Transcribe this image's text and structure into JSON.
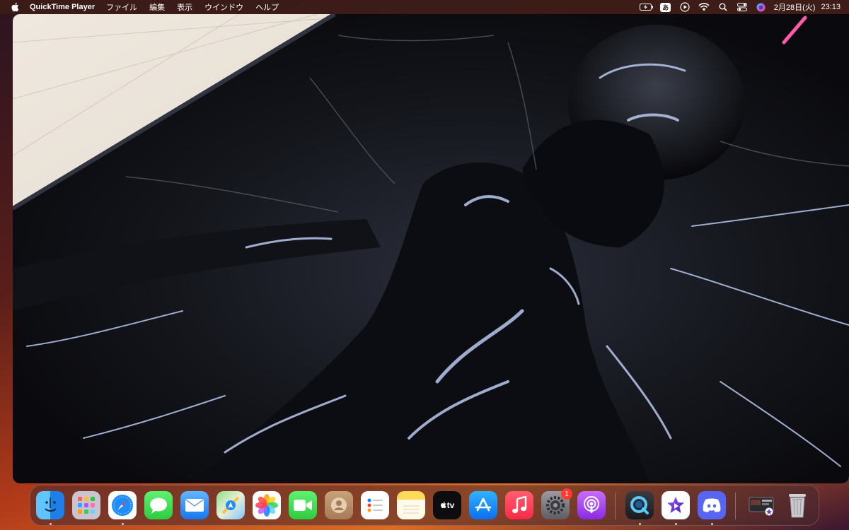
{
  "menubar": {
    "app_name": "QuickTime Player",
    "menus": [
      "ファイル",
      "編集",
      "表示",
      "ウインドウ",
      "ヘルプ"
    ],
    "input_method": "あ",
    "date": "2月28日(火)",
    "time": "23:13"
  },
  "player": {
    "content": "video-frame"
  },
  "dock": {
    "items": [
      {
        "name": "Finder",
        "icon": "finder-icon",
        "running": true
      },
      {
        "name": "Launchpad",
        "icon": "launchpad-icon",
        "running": false
      },
      {
        "name": "Safari",
        "icon": "safari-icon",
        "running": true
      },
      {
        "name": "Messages",
        "icon": "messages-icon",
        "running": false
      },
      {
        "name": "Mail",
        "icon": "mail-icon",
        "running": false
      },
      {
        "name": "Maps",
        "icon": "maps-icon",
        "running": false
      },
      {
        "name": "Photos",
        "icon": "photos-icon",
        "running": false
      },
      {
        "name": "FaceTime",
        "icon": "facetime-icon",
        "running": false
      },
      {
        "name": "Contacts",
        "icon": "contacts-icon",
        "running": false
      },
      {
        "name": "Reminders",
        "icon": "reminders-icon",
        "running": false
      },
      {
        "name": "Notes",
        "icon": "notes-icon",
        "running": false
      },
      {
        "name": "TV",
        "icon": "tv-icon",
        "label": "tv",
        "running": false
      },
      {
        "name": "App Store",
        "icon": "app-store-icon",
        "running": false
      },
      {
        "name": "Music",
        "icon": "music-icon",
        "running": false
      },
      {
        "name": "System Settings",
        "icon": "system-settings-icon",
        "badge": "1",
        "running": false
      },
      {
        "name": "Podcasts",
        "icon": "podcasts-icon",
        "running": false
      },
      {
        "name": "QuickTime Player",
        "icon": "quicktime-icon",
        "running": true
      },
      {
        "name": "iMovie",
        "icon": "imovie-icon",
        "running": true
      },
      {
        "name": "Discord",
        "icon": "discord-icon",
        "running": true
      },
      {
        "name": "Downloads",
        "icon": "downloads-stack-icon",
        "running": false
      },
      {
        "name": "Trash",
        "icon": "trash-icon",
        "running": false
      }
    ]
  },
  "colors": {
    "menubar_bg": "#3c1c18",
    "badge": "#ff3b30"
  }
}
